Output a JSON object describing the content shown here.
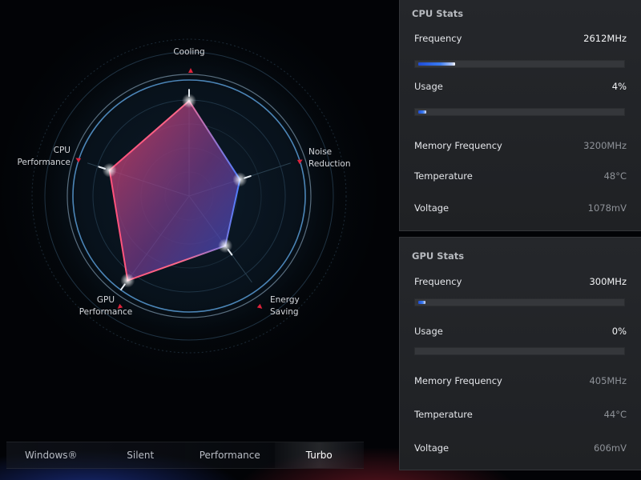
{
  "radar": {
    "axes": [
      {
        "name": "Cooling",
        "label": "Cooling"
      },
      {
        "name": "Noise Reduction",
        "label": "Noise\nReduction"
      },
      {
        "name": "Energy Saving",
        "label": "Energy\nSaving"
      },
      {
        "name": "GPU Performance",
        "label": "GPU\nPerformance"
      },
      {
        "name": "CPU Performance",
        "label": "CPU\nPerformance"
      }
    ],
    "values": [
      0.82,
      0.46,
      0.53,
      0.9,
      0.72
    ],
    "colors": {
      "fill_a": "#c4375c",
      "fill_b": "#3a48b8",
      "stroke_a": "#ff3d6a",
      "stroke_b": "#3d7bff",
      "accent": "#e0233c"
    }
  },
  "modes": {
    "items": [
      "Windows®",
      "Silent",
      "Performance",
      "Turbo"
    ],
    "selected": "Turbo"
  },
  "cpu": {
    "title": "CPU Stats",
    "frequency_label": "Frequency",
    "frequency_value": "2612MHz",
    "frequency_fill": 0.18,
    "usage_label": "Usage",
    "usage_value": "4%",
    "usage_fill": 0.04,
    "memory_frequency_label": "Memory Frequency",
    "memory_frequency_value": "3200MHz",
    "temperature_label": "Temperature",
    "temperature_value": "48°C",
    "voltage_label": "Voltage",
    "voltage_value": "1078mV"
  },
  "gpu": {
    "title": "GPU Stats",
    "frequency_label": "Frequency",
    "frequency_value": "300MHz",
    "frequency_fill": 0.035,
    "usage_label": "Usage",
    "usage_value": "0%",
    "usage_fill": 0,
    "memory_frequency_label": "Memory Frequency",
    "memory_frequency_value": "405MHz",
    "temperature_label": "Temperature",
    "temperature_value": "44°C",
    "voltage_label": "Voltage",
    "voltage_value": "606mV"
  }
}
